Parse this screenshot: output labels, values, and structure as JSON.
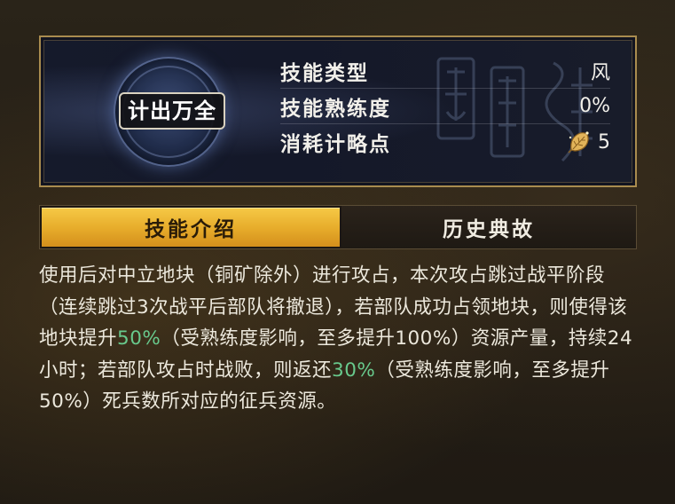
{
  "skill": {
    "name": "计出万全",
    "attributes": [
      {
        "label": "技能类型",
        "value": "风"
      },
      {
        "label": "技能熟练度",
        "value": "0%"
      },
      {
        "label": "消耗计略点",
        "value": "5",
        "icon": "strategy-leaf-icon"
      }
    ]
  },
  "tabs": [
    {
      "label": "技能介绍",
      "active": true
    },
    {
      "label": "历史典故",
      "active": false
    }
  ],
  "description": {
    "p1": "使用后对中立地块（铜矿除外）进行攻占，本次攻占跳过战平阶段（连续跳过3次战平后部队将撤退），若部队成功占领地块，则使得该地块提升",
    "hl1": "50%",
    "p2": "（受熟练度影响，至多提升100%）资源产量，持续24小时；若部队攻占时战败，则返还",
    "hl2": "30%",
    "p3": "（受熟练度影响，至多提升50%）死兵数所对应的征兵资源。"
  },
  "colors": {
    "highlight": "#68c98c",
    "tab_active": "#f0b93a",
    "frame_gold": "#a98c4f"
  }
}
